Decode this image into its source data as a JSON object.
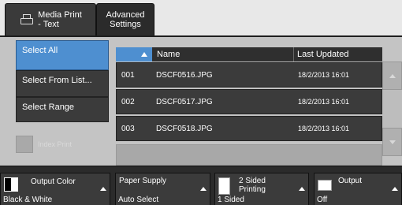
{
  "tabs": [
    {
      "label": "Media Print - Text"
    },
    {
      "label": "Advanced Settings"
    }
  ],
  "tab_labels": {
    "media_line1": "Media Print",
    "media_line2": "- Text",
    "adv_line1": "Advanced",
    "adv_line2": "Settings"
  },
  "selection": {
    "select_all": "Select All",
    "select_from_list": "Select From List...",
    "select_range": "Select Range"
  },
  "index_print": "Index Print",
  "table": {
    "columns": [
      "Name",
      "Last Updated"
    ],
    "rows": [
      {
        "no": "001",
        "name": "DSCF0516.JPG",
        "updated": "18/2/2013 16:01"
      },
      {
        "no": "002",
        "name": "DSCF0517.JPG",
        "updated": "18/2/2013 16:01"
      },
      {
        "no": "003",
        "name": "DSCF0518.JPG",
        "updated": "18/2/2013 16:01"
      }
    ]
  },
  "features": {
    "output_color": {
      "label": "Output Color",
      "value": "Black & White"
    },
    "paper_supply": {
      "label": "Paper Supply",
      "value": "Auto Select"
    },
    "two_sided": {
      "label_line1": "2 Sided",
      "label_line2": "Printing",
      "value": "1 Sided"
    },
    "output": {
      "label": "Output",
      "value": "Off"
    }
  },
  "colors": {
    "accent": "#4e8fd0",
    "panel": "#c4c4c4",
    "button": "#3b3b3b"
  }
}
